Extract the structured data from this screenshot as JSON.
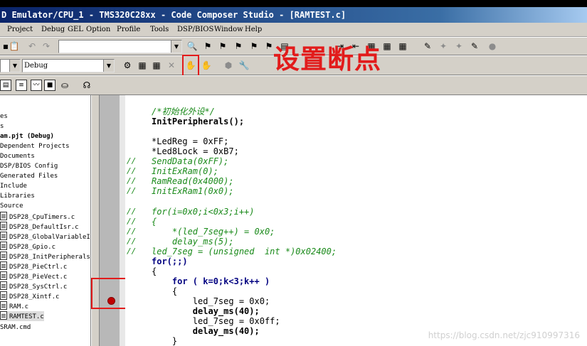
{
  "window": {
    "title": "D Emulator/CPU_1 - TMS320C28xx - Code Composer Studio - [RAMTEST.c]"
  },
  "menu": {
    "items": [
      "Project",
      "Debug",
      "GEL",
      "Option",
      "Profile",
      "Tools",
      "DSP/BIOS",
      "Window",
      "Help"
    ]
  },
  "toolbar": {
    "config_value": "Debug"
  },
  "annotation": {
    "label": "设置断点",
    "color": "#e21b1b"
  },
  "project_tree": {
    "items": [
      {
        "label": "es"
      },
      {
        "label": "s"
      },
      {
        "label": "am.pjt (Debug)"
      },
      {
        "label": "Dependent Projects"
      },
      {
        "label": "Documents"
      },
      {
        "label": "DSP/BIOS Config"
      },
      {
        "label": "Generated Files"
      },
      {
        "label": "Include"
      },
      {
        "label": "Libraries"
      },
      {
        "label": "Source"
      },
      {
        "label": "DSP28_CpuTimers.c"
      },
      {
        "label": "DSP28_DefaultIsr.c"
      },
      {
        "label": "DSP28_GlobalVariableI"
      },
      {
        "label": "DSP28_Gpio.c"
      },
      {
        "label": "DSP28_InitPeripherals"
      },
      {
        "label": "DSP28_PieCtrl.c"
      },
      {
        "label": "DSP28_PieVect.c"
      },
      {
        "label": "DSP28_SysCtrl.c"
      },
      {
        "label": "DSP28_Xintf.c"
      },
      {
        "label": "RAM.c"
      },
      {
        "label": "RAMTEST.c"
      },
      {
        "label": "SRAM.cmd"
      }
    ]
  },
  "code": {
    "lines": [
      "/*初始化外设*/",
      "InitPeripherals();",
      "",
      "*LedReg = 0xFF;",
      "*Led8Lock = 0xB7;",
      "SendData(0xFF);",
      "InitExRam(0);",
      "RamRead(0x4000);",
      "InitExRam1(0x0);",
      "",
      "for(i=0x0;i<0x3;i++)",
      "{",
      "    *(led_7seg++) = 0x0;",
      "    delay_ms(5);",
      "led_7seg = (unsigned  int *)0x02400;",
      "for(;;)",
      "{",
      "    for ( k=0;k<3;k++ )",
      "    {",
      "        led_7seg = 0x0;",
      "        delay_ms(40);",
      "        led_7seg = 0x0ff;",
      "        delay_ms(40);",
      "    }"
    ]
  },
  "watermark": "https://blog.csdn.net/zjc910997316"
}
